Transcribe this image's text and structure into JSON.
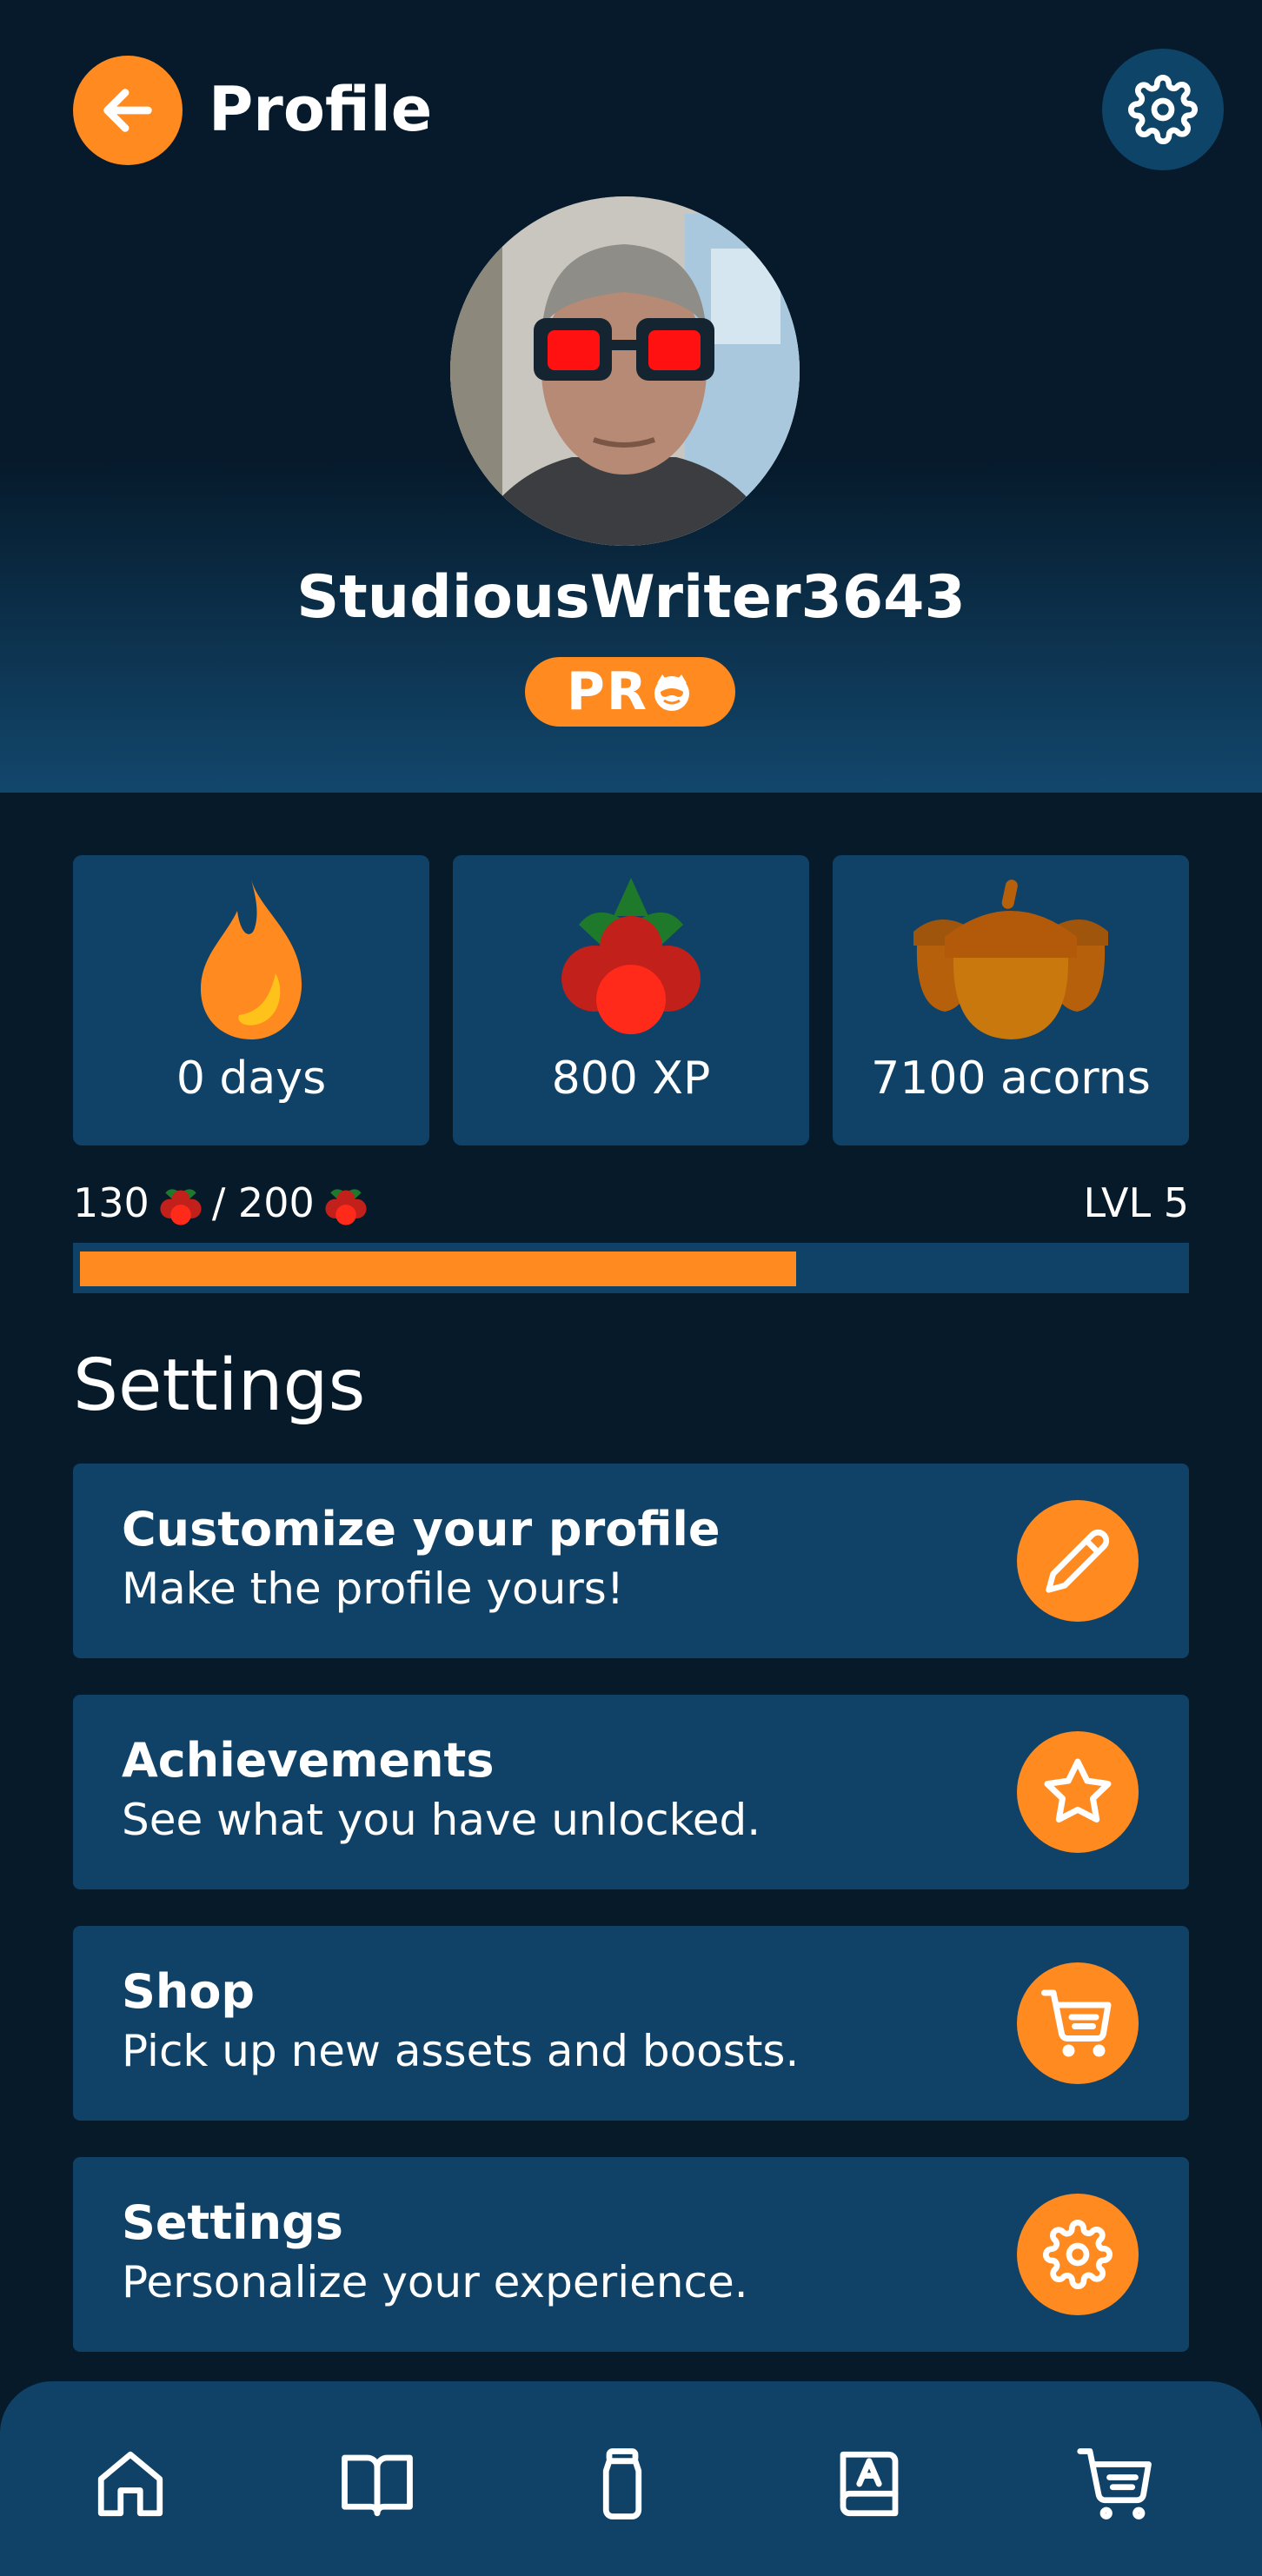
{
  "header": {
    "title": "Profile",
    "back_icon": "arrow-left-icon",
    "settings_icon": "gear-icon"
  },
  "profile": {
    "username": "StudiousWriter3643",
    "badge": "PR"
  },
  "stats": [
    {
      "label": "0 days",
      "icon": "flame-icon"
    },
    {
      "label": "800 XP",
      "icon": "berries-icon"
    },
    {
      "label": "7100 acorns",
      "icon": "acorns-icon"
    }
  ],
  "progress": {
    "current": "130",
    "separator": "/ 200",
    "level": "LVL 5",
    "fraction": 0.65
  },
  "settings_section": {
    "title": "Settings",
    "items": [
      {
        "title": "Customize your profile",
        "subtitle": "Make the profile yours!",
        "icon": "pencil-icon"
      },
      {
        "title": "Achievements",
        "subtitle": "See what you have unlocked.",
        "icon": "star-icon"
      },
      {
        "title": "Shop",
        "subtitle": "Pick up new assets and boosts.",
        "icon": "cart-icon"
      },
      {
        "title": "Settings",
        "subtitle": "Personalize your experience.",
        "icon": "gear-icon"
      }
    ]
  },
  "bottom_nav": [
    "home-icon",
    "book-icon",
    "jar-icon",
    "notebook-icon",
    "cart-icon"
  ],
  "colors": {
    "accent": "#ff8a1f",
    "card": "#0f4266",
    "background": "#071a2a"
  }
}
